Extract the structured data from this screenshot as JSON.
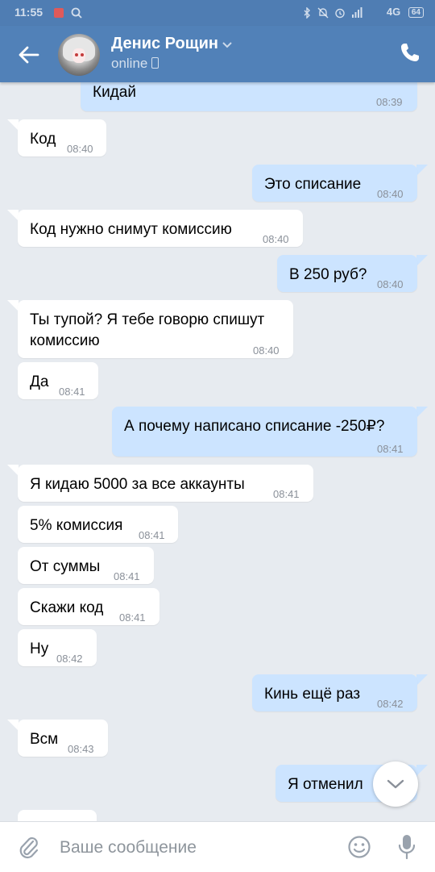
{
  "status_bar": {
    "time": "11:55",
    "network": "4G",
    "battery": "64"
  },
  "header": {
    "contact_name": "Денис Рощин",
    "status": "online"
  },
  "messages": [
    {
      "dir": "out",
      "text": "Кидай",
      "time": "08:39"
    },
    {
      "dir": "in",
      "text": "Код",
      "time": "08:40"
    },
    {
      "dir": "out",
      "text": "Это списание",
      "time": "08:40"
    },
    {
      "dir": "in",
      "text": "Код нужно снимут комиссию",
      "time": "08:40"
    },
    {
      "dir": "out",
      "text": "В 250 руб?",
      "time": "08:40"
    },
    {
      "dir": "in",
      "text_line1": "Ты тупой? Я тебе говорю спишут",
      "text_line2": "комиссию",
      "time": "08:40"
    },
    {
      "dir": "in",
      "text": "Да",
      "time": "08:41"
    },
    {
      "dir": "out",
      "text": "А почему написано списание -250₽?",
      "time": "08:41"
    },
    {
      "dir": "in",
      "text": "Я кидаю 5000 за все аккаунты",
      "time": "08:41"
    },
    {
      "dir": "in",
      "text": "5% комиссия",
      "time": "08:41"
    },
    {
      "dir": "in",
      "text": "От суммы",
      "time": "08:41"
    },
    {
      "dir": "in",
      "text": "Скажи код",
      "time": "08:41"
    },
    {
      "dir": "in",
      "text": "Ну",
      "time": "08:42"
    },
    {
      "dir": "out",
      "text": "Кинь ещё раз",
      "time": "08:42"
    },
    {
      "dir": "in",
      "text": "Всм",
      "time": "08:43"
    },
    {
      "dir": "out",
      "text": "Я отменил",
      "time": ""
    }
  ],
  "composer": {
    "placeholder": "Ваше сообщение"
  },
  "colors": {
    "header": "#5181b8",
    "background": "#e7ebf0",
    "outgoing": "#cce4ff",
    "incoming": "#ffffff"
  }
}
